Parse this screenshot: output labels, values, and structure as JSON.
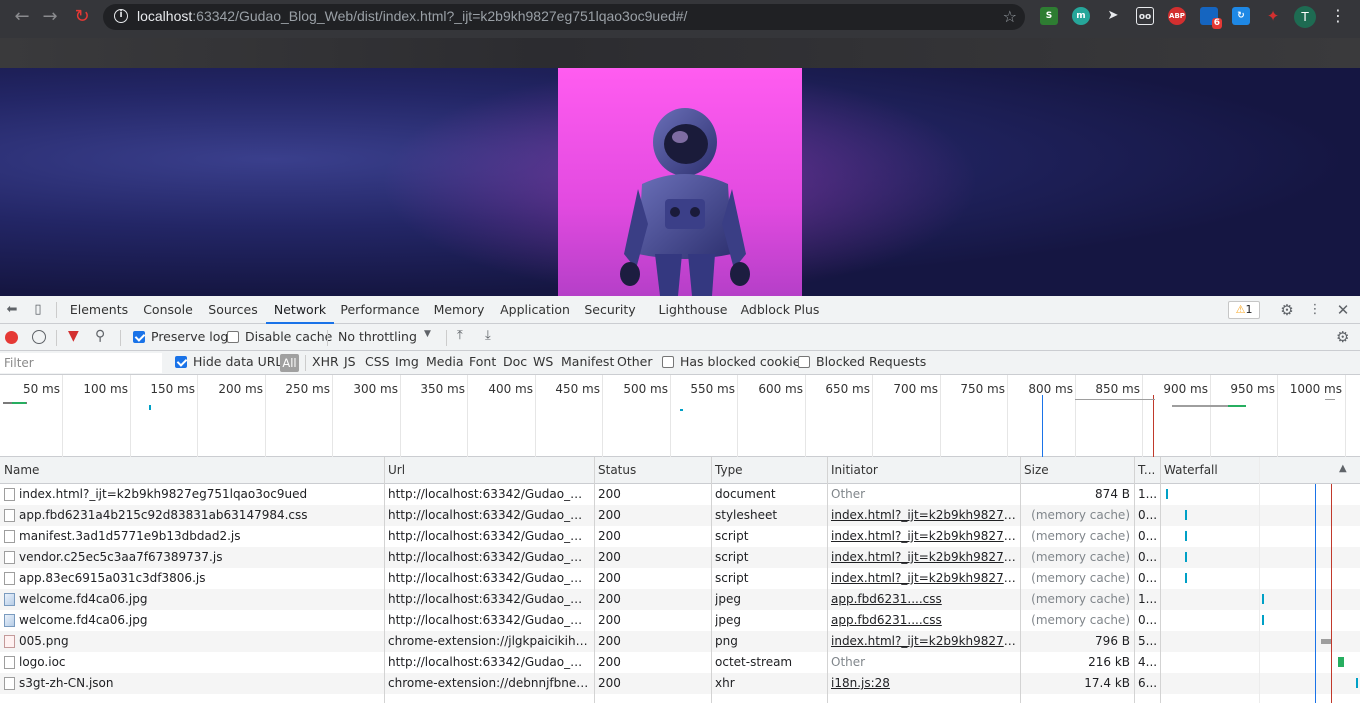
{
  "browser": {
    "url_host": "localhost",
    "url_rest": ":63342/Gudao_Blog_Web/dist/index.html?_ijt=k2b9kh9827eg751lqao3oc9ued#/",
    "extension_badge": "6",
    "extensions": [
      "Office",
      "m",
      "cursor",
      "glasses",
      "ABP",
      "badge",
      "sync",
      "puzzle"
    ],
    "avatar_letter": "T",
    "abp_label": "ABP",
    "m_label": "m"
  },
  "devtools": {
    "tabs": [
      "Elements",
      "Console",
      "Sources",
      "Network",
      "Performance",
      "Memory",
      "Application",
      "Security",
      "Lighthouse",
      "Adblock Plus"
    ],
    "active_tab": "Network",
    "warning_count": "1",
    "toolbar": {
      "preserve_log": "Preserve log",
      "disable_cache": "Disable cache",
      "throttling": "No throttling"
    },
    "filterbar": {
      "placeholder": "Filter",
      "hide_data_urls": "Hide data URLs",
      "types": [
        "All",
        "XHR",
        "JS",
        "CSS",
        "Img",
        "Media",
        "Font",
        "Doc",
        "WS",
        "Manifest",
        "Other"
      ],
      "has_blocked_cookies": "Has blocked cookies",
      "blocked_requests": "Blocked Requests"
    },
    "overview_ticks": [
      "50 ms",
      "100 ms",
      "150 ms",
      "200 ms",
      "250 ms",
      "300 ms",
      "350 ms",
      "400 ms",
      "450 ms",
      "500 ms",
      "550 ms",
      "600 ms",
      "650 ms",
      "700 ms",
      "750 ms",
      "800 ms",
      "850 ms",
      "900 ms",
      "950 ms",
      "1000 ms"
    ],
    "columns": {
      "name": "Name",
      "url": "Url",
      "status": "Status",
      "type": "Type",
      "initiator": "Initiator",
      "size": "Size",
      "time": "T...",
      "waterfall": "Waterfall"
    },
    "rows": [
      {
        "name": "index.html?_ijt=k2b9kh9827eg751lqao3oc9ued",
        "url": "http://localhost:63342/Gudao_Blog_...",
        "status": "200",
        "type": "document",
        "initiator": "Other",
        "initiator_link": false,
        "size": "874 B",
        "size_muted": false,
        "time": "1...",
        "icon": "doc"
      },
      {
        "name": "app.fbd6231a4b215c92d83831ab63147984.css",
        "url": "http://localhost:63342/Gudao_Blog_...",
        "status": "200",
        "type": "stylesheet",
        "initiator": "index.html?_ijt=k2b9kh9827eg75...",
        "initiator_link": true,
        "size": "(memory cache)",
        "size_muted": true,
        "time": "0...",
        "icon": "doc"
      },
      {
        "name": "manifest.3ad1d5771e9b13dbdad2.js",
        "url": "http://localhost:63342/Gudao_Blog_...",
        "status": "200",
        "type": "script",
        "initiator": "index.html?_ijt=k2b9kh9827eg75...",
        "initiator_link": true,
        "size": "(memory cache)",
        "size_muted": true,
        "time": "0...",
        "icon": "doc"
      },
      {
        "name": "vendor.c25ec5c3aa7f67389737.js",
        "url": "http://localhost:63342/Gudao_Blog_...",
        "status": "200",
        "type": "script",
        "initiator": "index.html?_ijt=k2b9kh9827eg75...",
        "initiator_link": true,
        "size": "(memory cache)",
        "size_muted": true,
        "time": "0...",
        "icon": "doc"
      },
      {
        "name": "app.83ec6915a031c3df3806.js",
        "url": "http://localhost:63342/Gudao_Blog_...",
        "status": "200",
        "type": "script",
        "initiator": "index.html?_ijt=k2b9kh9827eg75...",
        "initiator_link": true,
        "size": "(memory cache)",
        "size_muted": true,
        "time": "0...",
        "icon": "doc"
      },
      {
        "name": "welcome.fd4ca06.jpg",
        "url": "http://localhost:63342/Gudao_Blog_...",
        "status": "200",
        "type": "jpeg",
        "initiator": "app.fbd6231....css",
        "initiator_link": true,
        "size": "(memory cache)",
        "size_muted": true,
        "time": "1...",
        "icon": "img"
      },
      {
        "name": "welcome.fd4ca06.jpg",
        "url": "http://localhost:63342/Gudao_Blog_...",
        "status": "200",
        "type": "jpeg",
        "initiator": "app.fbd6231....css",
        "initiator_link": true,
        "size": "(memory cache)",
        "size_muted": true,
        "time": "0...",
        "icon": "img"
      },
      {
        "name": "005.png",
        "url": "chrome-extension://jlgkpaicikihijad...",
        "status": "200",
        "type": "png",
        "initiator": "index.html?_ijt=k2b9kh9827eg75...",
        "initiator_link": true,
        "size": "796 B",
        "size_muted": false,
        "time": "5...",
        "icon": "png"
      },
      {
        "name": "logo.ioc",
        "url": "http://localhost:63342/Gudao_Blog_...",
        "status": "200",
        "type": "octet-stream",
        "initiator": "Other",
        "initiator_link": false,
        "size": "216 kB",
        "size_muted": false,
        "time": "4...",
        "icon": "doc"
      },
      {
        "name": "s3gt-zh-CN.json",
        "url": "chrome-extension://debnnjfbneojb...",
        "status": "200",
        "type": "xhr",
        "initiator": "i18n.js:28",
        "initiator_link": true,
        "size": "17.4 kB",
        "size_muted": false,
        "time": "6...",
        "icon": "doc"
      }
    ]
  }
}
